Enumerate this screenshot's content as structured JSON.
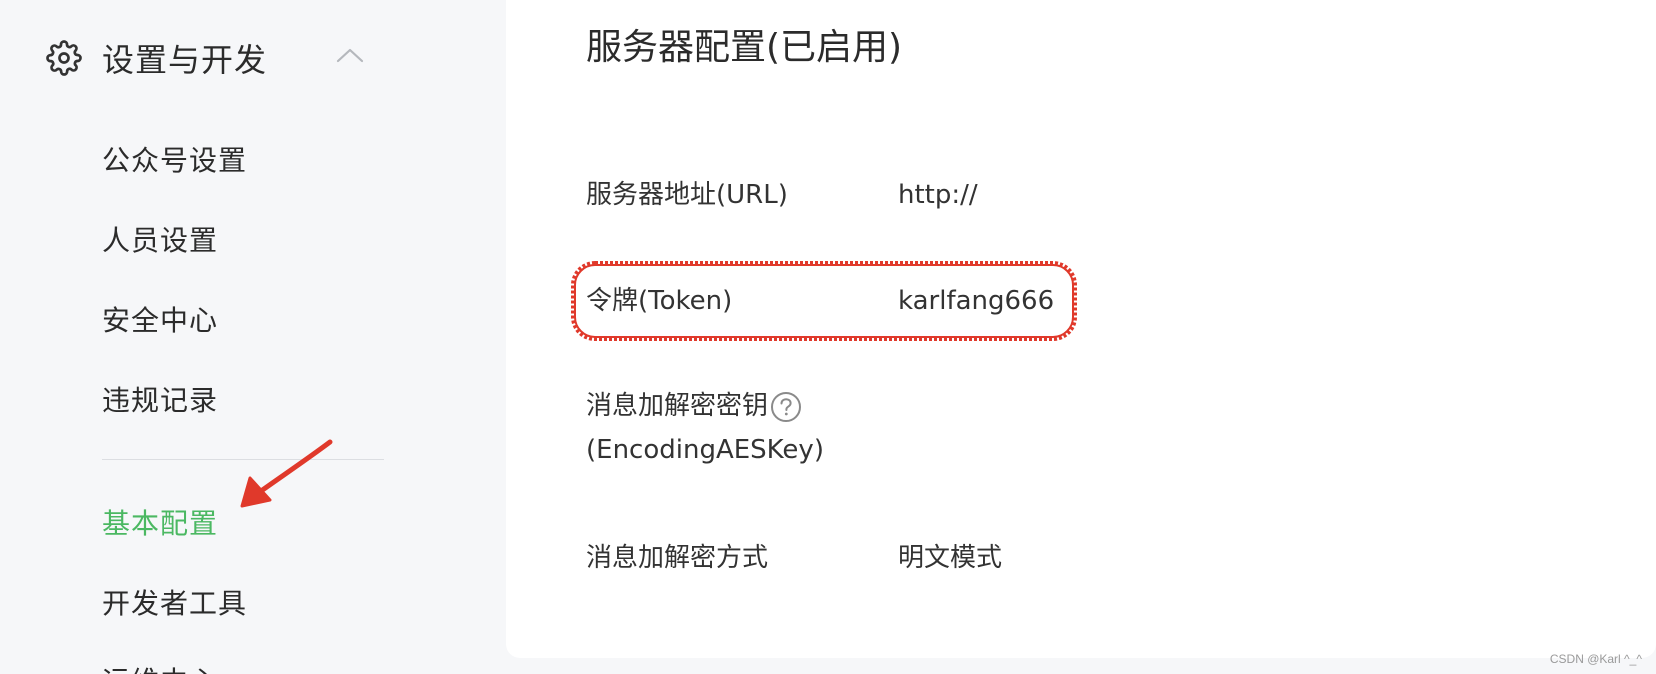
{
  "sidebar": {
    "section": {
      "title": "设置与开发",
      "icon": "gear-icon",
      "toggle_icon": "chevron-up-icon"
    },
    "items": [
      {
        "label": "公众号设置"
      },
      {
        "label": "人员设置"
      },
      {
        "label": "安全中心"
      },
      {
        "label": "违规记录"
      },
      {
        "label": "基本配置",
        "active": true
      },
      {
        "label": "开发者工具"
      },
      {
        "label": "运维中心"
      }
    ],
    "active_color": "#4bb862"
  },
  "main": {
    "title": "服务器配置(已启用)",
    "rows": [
      {
        "label": "服务器地址(URL)",
        "value": "http://"
      },
      {
        "label": "令牌(Token)",
        "value": "karlfang666"
      },
      {
        "label_line1": "消息加解密密钥",
        "label_line2": "(EncodingAESKey)",
        "value": "",
        "icon": "question-circle-icon"
      },
      {
        "label": "消息加解密方式",
        "value": "明文模式"
      }
    ]
  },
  "annotations": {
    "highlight_color": "#e0392b",
    "arrow_color": "#e0392b"
  },
  "watermark": "CSDN @Karl ^_^"
}
